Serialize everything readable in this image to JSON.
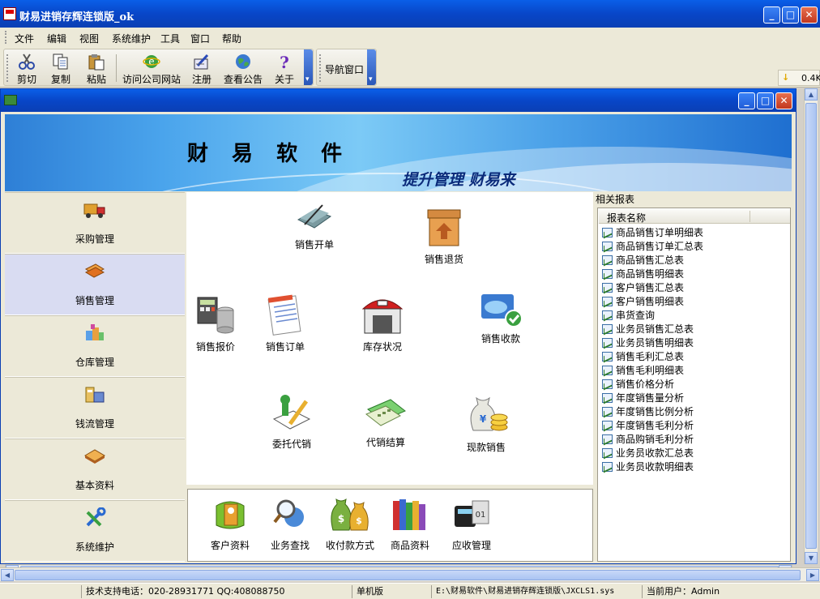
{
  "window": {
    "title": "财易进销存辉连锁版_ok"
  },
  "menu": [
    "文件",
    "编辑",
    "视图",
    "系统维护",
    "工具",
    "窗口",
    "帮助"
  ],
  "toolbar": {
    "buttons": [
      {
        "label": "剪切",
        "icon": "scissors-icon"
      },
      {
        "label": "复制",
        "icon": "copy-icon"
      },
      {
        "label": "粘贴",
        "icon": "paste-icon"
      },
      {
        "label": "访问公司网站",
        "icon": "ie-globe-icon"
      },
      {
        "label": "注册",
        "icon": "register-icon"
      },
      {
        "label": "查看公告",
        "icon": "globe-icon"
      },
      {
        "label": "关于",
        "icon": "help-icon"
      }
    ],
    "nav_window_label": "导航窗口",
    "speed": "0.4K"
  },
  "banner": {
    "brand": "财 易 软 件",
    "slogan": "提升管理 财易来"
  },
  "leftnav": {
    "items": [
      "采购管理",
      "销售管理",
      "仓库管理",
      "钱流管理",
      "基本资料",
      "系统维护"
    ],
    "active": "销售管理"
  },
  "functions": [
    "销售开单",
    "销售退货",
    "销售报价",
    "销售订单",
    "库存状况",
    "销售收款",
    "委托代销",
    "代销结算",
    "现款销售"
  ],
  "quick": [
    "客户资料",
    "业务查找",
    "收付款方式",
    "商品资料",
    "应收管理"
  ],
  "reports": {
    "title": "相关报表",
    "column": "报表名称",
    "items": [
      "商品销售订单明细表",
      "商品销售订单汇总表",
      "商品销售汇总表",
      "商品销售明细表",
      "客户销售汇总表",
      "客户销售明细表",
      "串货查询",
      "业务员销售汇总表",
      "业务员销售明细表",
      "销售毛利汇总表",
      "销售毛利明细表",
      "销售价格分析",
      "年度销售量分析",
      "年度销售比例分析",
      "年度销售毛利分析",
      "商品购销毛利分析",
      "业务员收款汇总表",
      "业务员收款明细表"
    ]
  },
  "status": {
    "support": "技术支持电话：020-28931771 QQ:408088750",
    "mode": "单机版",
    "path": "E:\\财易软件\\财易进销存辉连锁版\\JXCLS1.sys",
    "user": "当前用户：Admin"
  }
}
